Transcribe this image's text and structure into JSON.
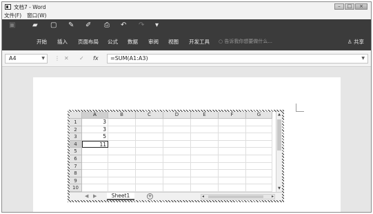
{
  "window": {
    "title": "文档7 - Word",
    "min_label": "–",
    "max_label": "□",
    "close_label": "×"
  },
  "menubar": {
    "items": [
      "文件(F)",
      "窗口(W)"
    ]
  },
  "ribbon": {
    "tabs": [
      "开始",
      "插入",
      "页面布局",
      "公式",
      "数据",
      "审阅",
      "视图",
      "开发工具"
    ],
    "tell_me": "告诉我你想要做什么...",
    "share_label": "共享"
  },
  "formula_bar": {
    "name_box": "A4",
    "fx": "fx",
    "cancel": "✕",
    "enter": "✓",
    "formula": "=SUM(A1:A3)"
  },
  "spreadsheet": {
    "columns": [
      "A",
      "B",
      "C",
      "D",
      "E",
      "F",
      "G"
    ],
    "rows": [
      "1",
      "2",
      "3",
      "4",
      "5",
      "6",
      "7",
      "8",
      "9",
      "10"
    ],
    "cells": {
      "A1": "3",
      "A2": "3",
      "A3": "5",
      "A4": "11"
    },
    "active_cell": "A4",
    "sheet_tab": "Sheet1",
    "add_sheet": "+"
  }
}
